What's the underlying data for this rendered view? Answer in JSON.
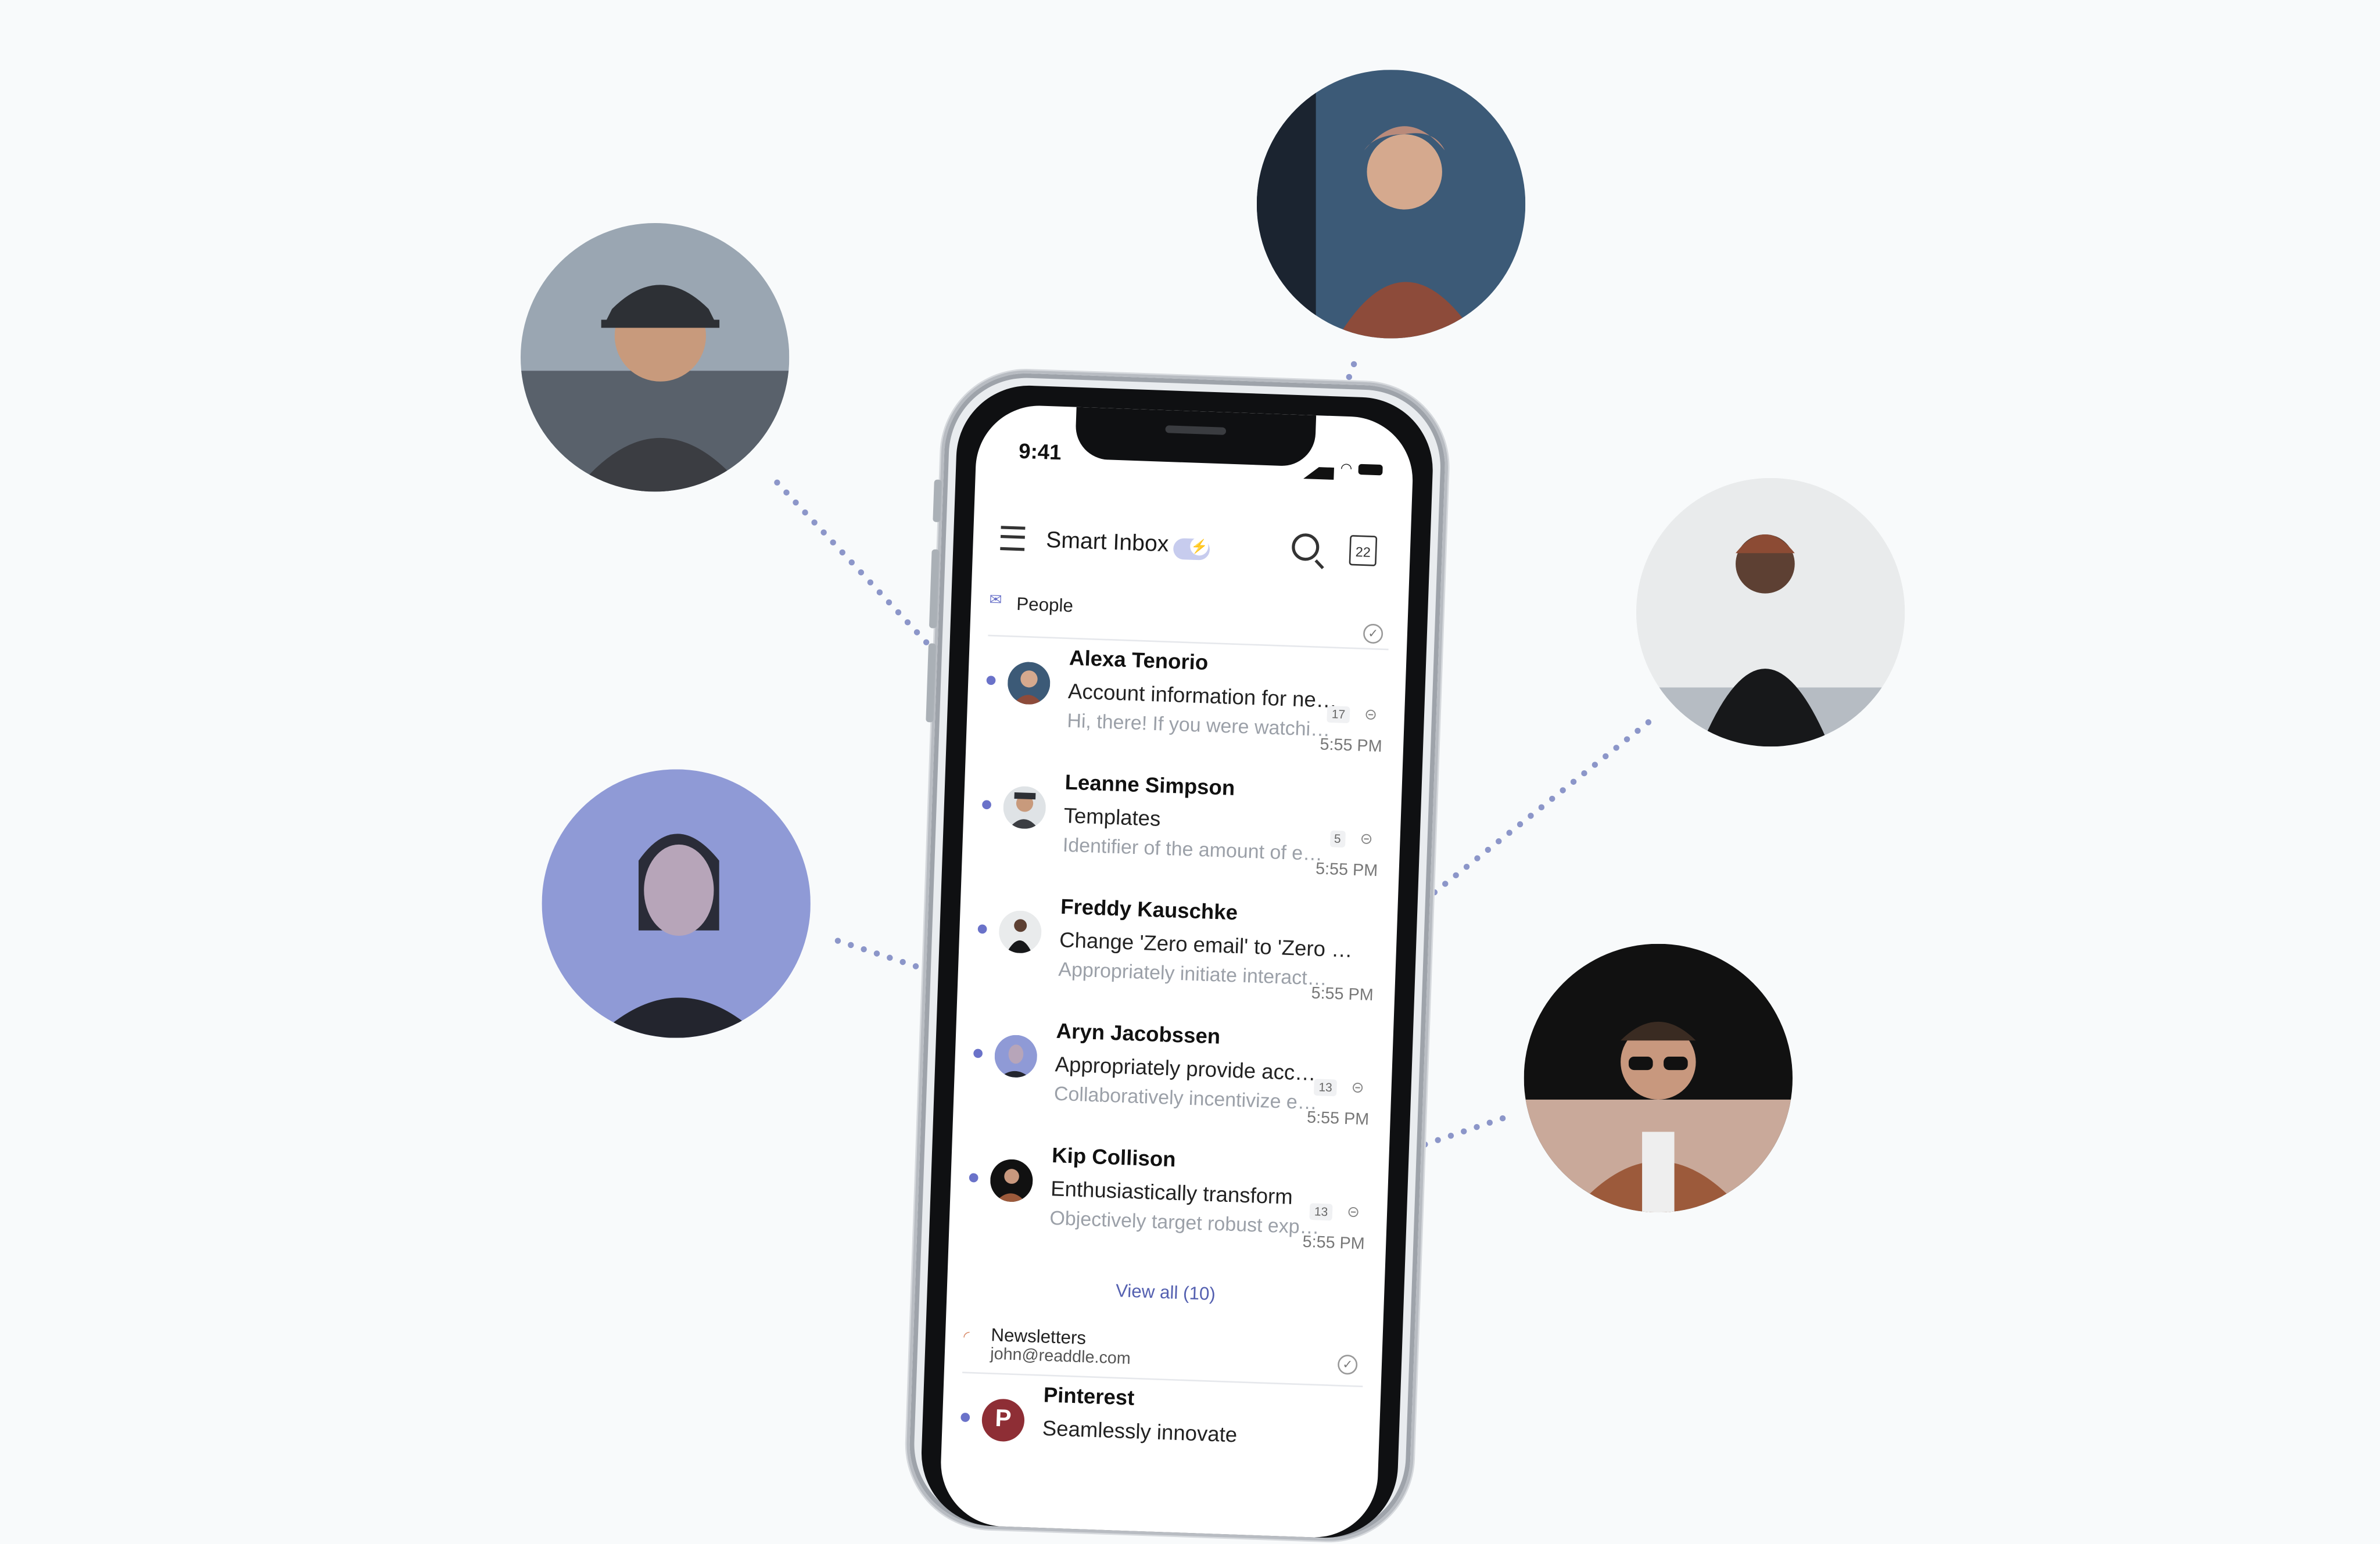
{
  "status_bar": {
    "time": "9:41"
  },
  "toolbar": {
    "title": "Smart Inbox",
    "calendar_day": "22"
  },
  "people_section": {
    "label": "People",
    "emails": [
      {
        "sender": "Alexa Tenorio",
        "subject": "Account information for new ...",
        "preview": "Hi, there! If you were watching ...",
        "count": "17",
        "time": "5:55 PM"
      },
      {
        "sender": "Leanne Simpson",
        "subject": "Templates",
        "preview": "Identifier of the amount of ema...",
        "count": "5",
        "time": "5:55 PM"
      },
      {
        "sender": "Freddy Kauschke",
        "subject": "Change 'Zero email' to 'Zero emails'",
        "preview": "Appropriately initiate interactive...",
        "count": "",
        "time": "5:55 PM"
      },
      {
        "sender": "Aryn Jacobssen",
        "subject": "Appropriately provide access",
        "preview": "Collaboratively incentivize exce...",
        "count": "13",
        "time": "5:55 PM"
      },
      {
        "sender": "Kip Collison",
        "subject": "Enthusiastically transform",
        "preview": "Objectively target robust expe...",
        "count": "13",
        "time": "5:55 PM"
      }
    ],
    "view_all": "View all (10)"
  },
  "newsletters_section": {
    "label": "Newsletters",
    "account": "john@readdle.com",
    "emails": [
      {
        "sender": "Pinterest",
        "subject": "Seamlessly innovate"
      }
    ]
  },
  "colors": {
    "accent": "#6a72c9",
    "connector": "#8c96c9",
    "background": "#f8fafb"
  }
}
